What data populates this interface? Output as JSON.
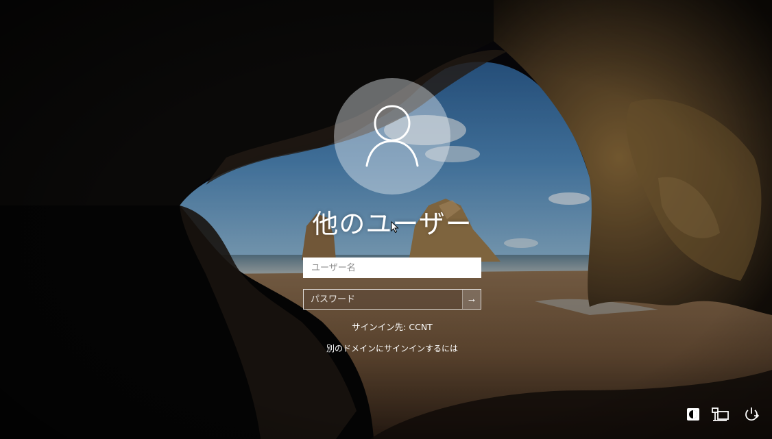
{
  "login": {
    "user_title": "他のユーザー",
    "username_placeholder": "ユーザー名",
    "password_placeholder": "パスワード",
    "submit_glyph": "→",
    "signin_to": "サインイン先: CCNT",
    "other_domain_link": "別のドメインにサインインするには"
  },
  "icons": {
    "avatar": "user-silhouette-icon",
    "submit": "arrow-right-icon",
    "ease_of_access": "ease-of-access-icon",
    "network": "network-icon",
    "power": "power-icon"
  }
}
